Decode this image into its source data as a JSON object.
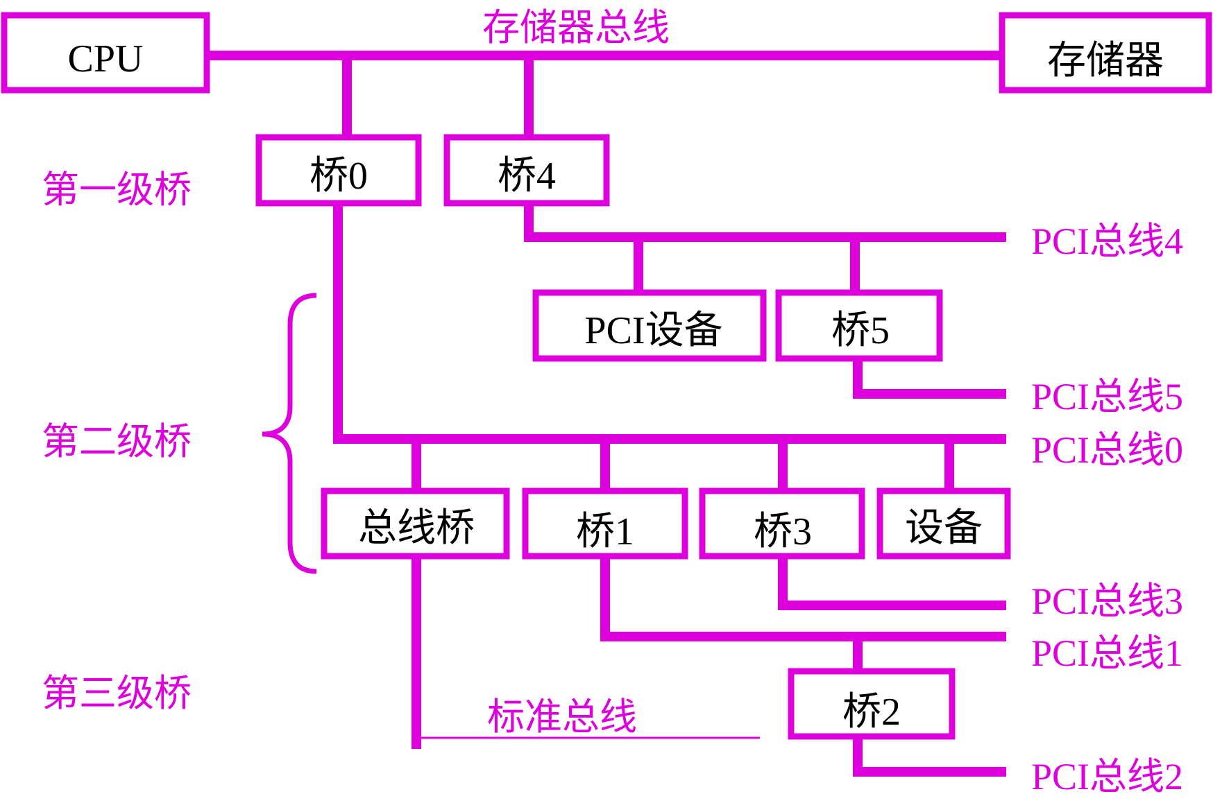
{
  "colors": {
    "accent": "#dd00dd",
    "text": "#000000",
    "background": "#ffffff"
  },
  "memory_bus": {
    "label": "存储器总线"
  },
  "standard_bus": {
    "label": "标准总线"
  },
  "levels": {
    "level1": "第一级桥",
    "level2": "第二级桥",
    "level3": "第三级桥"
  },
  "nodes": {
    "cpu": "CPU",
    "memory": "存储器",
    "bridge0": "桥0",
    "bridge4": "桥4",
    "pci_device": "PCI设备",
    "bridge5": "桥5",
    "bus_bridge": "总线桥",
    "bridge1": "桥1",
    "bridge3": "桥3",
    "device": "设备",
    "bridge2": "桥2"
  },
  "pci_buses": {
    "bus4": "PCI总线4",
    "bus5": "PCI总线5",
    "bus0": "PCI总线0",
    "bus3": "PCI总线3",
    "bus1": "PCI总线1",
    "bus2": "PCI总线2"
  }
}
